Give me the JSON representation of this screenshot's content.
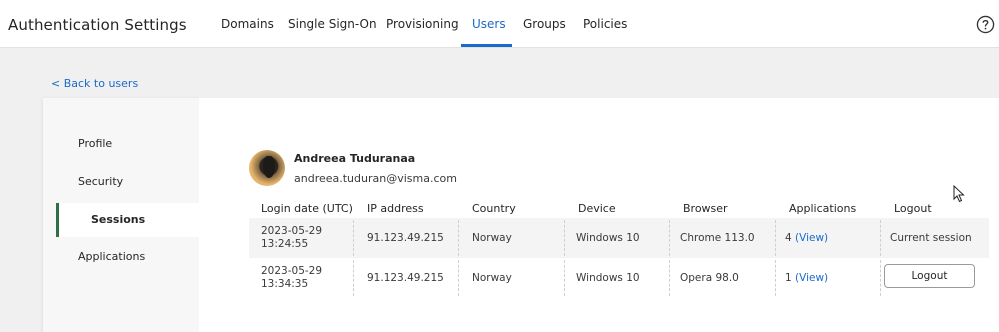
{
  "header": {
    "title": "Authentication Settings",
    "tabs": [
      {
        "label": "Domains"
      },
      {
        "label": "Single Sign-On"
      },
      {
        "label": "Provisioning"
      },
      {
        "label": "Users"
      },
      {
        "label": "Groups"
      },
      {
        "label": "Policies"
      }
    ],
    "active_tab": "Users",
    "help_icon": "help-circle-icon"
  },
  "back_link": "< Back to users",
  "sidebar": {
    "items": [
      {
        "label": "Profile"
      },
      {
        "label": "Security"
      },
      {
        "label": "Sessions"
      },
      {
        "label": "Applications"
      }
    ],
    "active": "Sessions"
  },
  "user": {
    "name": "Andreea Tuduranaa",
    "email": "andreea.tuduran@visma.com"
  },
  "table": {
    "columns": [
      "Login date (UTC)",
      "IP address",
      "Country",
      "Device",
      "Browser",
      "Applications",
      "Logout"
    ],
    "rows": [
      {
        "date": "2023-05-29",
        "time": "13:24:55",
        "ip": "91.123.49.215",
        "country": "Norway",
        "device": "Windows 10",
        "browser": "Chrome 113.0",
        "app_count": "4",
        "app_link": "(View)",
        "logout": "Current session"
      },
      {
        "date": "2023-05-29",
        "time": "13:34:35",
        "ip": "91.123.49.215",
        "country": "Norway",
        "device": "Windows 10",
        "browser": "Opera 98.0",
        "app_count": "1",
        "app_link": "(View)",
        "logout": "Logout"
      }
    ]
  },
  "colors": {
    "accent": "#1b6ac9",
    "active_marker": "#2d7048",
    "background": "#f0f0f0"
  }
}
